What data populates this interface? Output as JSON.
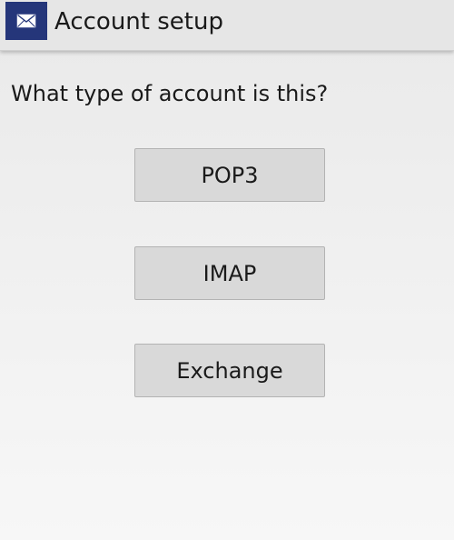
{
  "action_bar": {
    "title": "Account setup",
    "icon": "envelope-icon",
    "icon_background": "#25367a"
  },
  "prompt": {
    "question": "What type of account is this?"
  },
  "account_types": [
    {
      "label": "POP3"
    },
    {
      "label": "IMAP"
    },
    {
      "label": "Exchange"
    }
  ],
  "colors": {
    "button_background": "#d9d9d9",
    "button_border": "#b3b3b3",
    "action_bar_background": "#e6e6e6"
  }
}
